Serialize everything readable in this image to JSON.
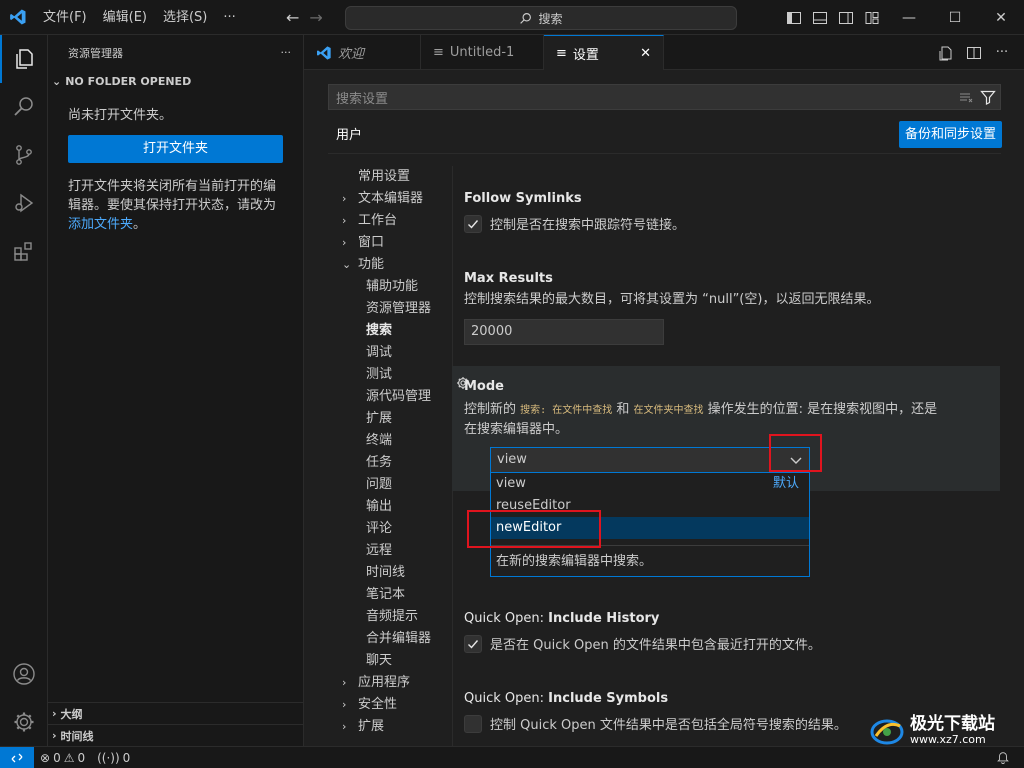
{
  "titlebar": {
    "menus": [
      "文件(F)",
      "编辑(E)",
      "选择(S)",
      "···"
    ],
    "search_text": "搜索"
  },
  "sidebar": {
    "title": "资源管理器",
    "more": "···",
    "section": "NO FOLDER OPENED",
    "message": "尚未打开文件夹。",
    "open_folder_button": "打开文件夹",
    "description": "打开文件夹将关闭所有当前打开的编辑器。要使其保持打开状态，请改为",
    "add_folder_link": "添加文件夹",
    "description_end": "。",
    "outline": "大纲",
    "timeline": "时间线"
  },
  "tabs": [
    {
      "label": "欢迎",
      "icon": "vscode-icon"
    },
    {
      "label": "Untitled-1",
      "icon": "file-icon"
    },
    {
      "label": "设置",
      "icon": "settings-file-icon",
      "close": "✕"
    }
  ],
  "settings": {
    "search_placeholder": "搜索设置",
    "user_tab": "用户",
    "sync_button": "备份和同步设置",
    "toc": [
      {
        "label": "常用设置",
        "level": 0,
        "chevron": ""
      },
      {
        "label": "文本编辑器",
        "level": 0,
        "chevron": "›"
      },
      {
        "label": "工作台",
        "level": 0,
        "chevron": "›"
      },
      {
        "label": "窗口",
        "level": 0,
        "chevron": "›"
      },
      {
        "label": "功能",
        "level": 0,
        "chevron": "⌄"
      },
      {
        "label": "辅助功能",
        "level": 1,
        "chevron": ""
      },
      {
        "label": "资源管理器",
        "level": 1,
        "chevron": ""
      },
      {
        "label": "搜索",
        "level": 1,
        "chevron": "",
        "active": true
      },
      {
        "label": "调试",
        "level": 1,
        "chevron": ""
      },
      {
        "label": "测试",
        "level": 1,
        "chevron": ""
      },
      {
        "label": "源代码管理",
        "level": 1,
        "chevron": ""
      },
      {
        "label": "扩展",
        "level": 1,
        "chevron": ""
      },
      {
        "label": "终端",
        "level": 1,
        "chevron": ""
      },
      {
        "label": "任务",
        "level": 1,
        "chevron": ""
      },
      {
        "label": "问题",
        "level": 1,
        "chevron": ""
      },
      {
        "label": "输出",
        "level": 1,
        "chevron": ""
      },
      {
        "label": "评论",
        "level": 1,
        "chevron": ""
      },
      {
        "label": "远程",
        "level": 1,
        "chevron": ""
      },
      {
        "label": "时间线",
        "level": 1,
        "chevron": ""
      },
      {
        "label": "笔记本",
        "level": 1,
        "chevron": ""
      },
      {
        "label": "音频提示",
        "level": 1,
        "chevron": ""
      },
      {
        "label": "合并编辑器",
        "level": 1,
        "chevron": ""
      },
      {
        "label": "聊天",
        "level": 1,
        "chevron": ""
      },
      {
        "label": "应用程序",
        "level": 0,
        "chevron": "›"
      },
      {
        "label": "安全性",
        "level": 0,
        "chevron": "›"
      },
      {
        "label": "扩展",
        "level": 0,
        "chevron": "›"
      }
    ],
    "follow_symlinks": {
      "title": "Follow Symlinks",
      "description": "控制是否在搜索中跟踪符号链接。",
      "checked": true
    },
    "max_results": {
      "title": "Max Results",
      "description": "控制搜索结果的最大数目，可将其设置为 “null”(空)，以返回无限结果。",
      "value": "20000"
    },
    "mode": {
      "title": "Mode",
      "desc_prefix": "控制新的",
      "code1": "搜索: 在文件中查找",
      "desc_and": "和",
      "code2": "在文件夹中查找",
      "desc_suffix": "操作发生的位置: 是在搜索视图中，还是",
      "desc_line2": "在搜索编辑器中。",
      "current": "view",
      "options": [
        {
          "label": "view",
          "badge": "默认"
        },
        {
          "label": "reuseEditor",
          "badge": ""
        },
        {
          "label": "newEditor",
          "badge": "",
          "selected": true
        }
      ],
      "option_description": "在新的搜索编辑器中搜索。"
    },
    "include_history": {
      "category": "Quick Open: ",
      "title": "Include History",
      "description": "是否在 Quick Open 的文件结果中包含最近打开的文件。",
      "checked": true
    },
    "include_symbols": {
      "category": "Quick Open: ",
      "title": "Include Symbols",
      "description": "控制 Quick Open 文件结果中是否包括全局符号搜索的结果。",
      "checked": false
    }
  },
  "statusbar": {
    "errors": "0",
    "warnings": "0",
    "ports": "0"
  },
  "watermark": {
    "text": "极光下载站",
    "url": "www.xz7.com"
  },
  "colors": {
    "accent": "#0078d4",
    "highlight_box": "#e0141e"
  }
}
